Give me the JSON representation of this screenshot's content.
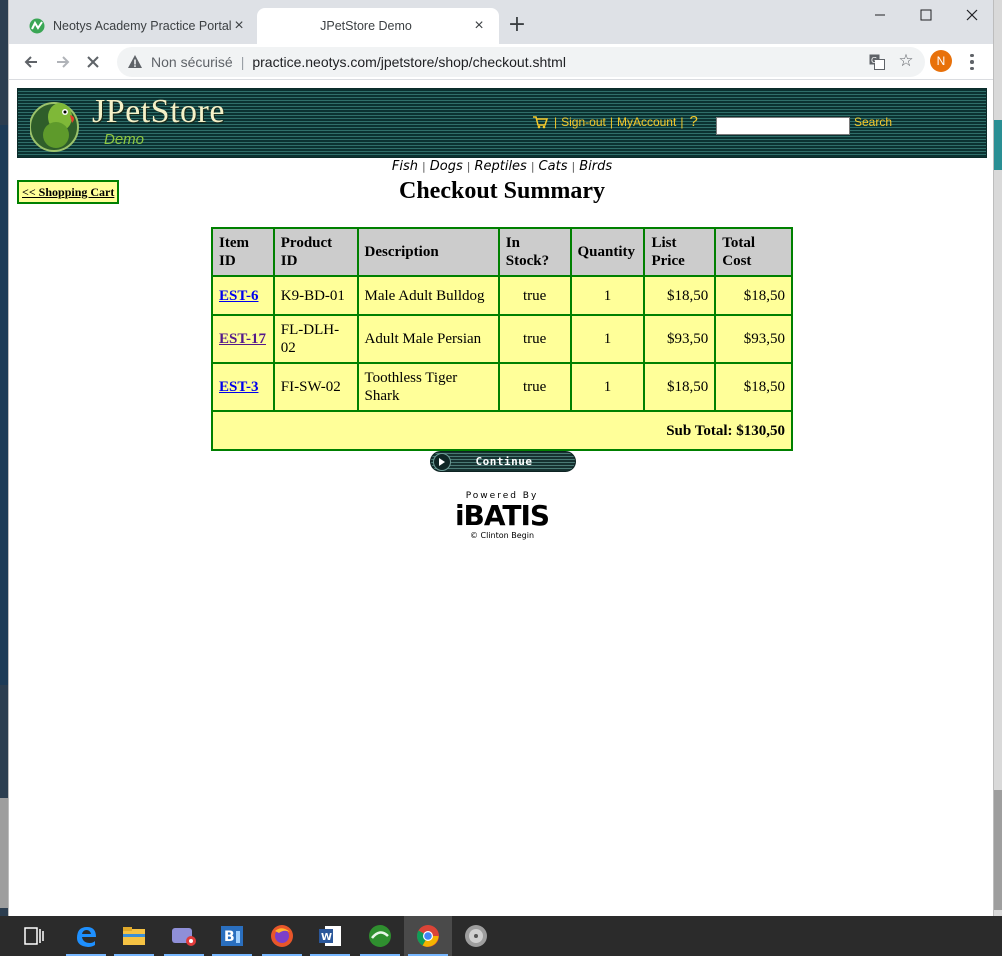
{
  "browser": {
    "tabs": [
      {
        "title": "Neotys Academy Practice Portal",
        "active": false
      },
      {
        "title": "JPetStore Demo",
        "active": true
      }
    ],
    "security_label": "Non sécurisé",
    "url": "practice.neotys.com/jpetstore/shop/checkout.shtml",
    "profile_initial": "N"
  },
  "header": {
    "logo_title": "JPetStore",
    "logo_subtitle": "Demo",
    "sign_out": "Sign-out",
    "my_account": "MyAccount",
    "help": "?",
    "search_label": "Search",
    "search_value": ""
  },
  "categories": [
    "Fish",
    "Dogs",
    "Reptiles",
    "Cats",
    "Birds"
  ],
  "back_link": "<< Shopping Cart",
  "page_title": "Checkout Summary",
  "table": {
    "headers": [
      "Item ID",
      "Product ID",
      "Description",
      "In Stock?",
      "Quantity",
      "List Price",
      "Total Cost"
    ],
    "rows": [
      {
        "item_id": "EST-6",
        "product_id": "K9-BD-01",
        "description": "Male Adult Bulldog",
        "in_stock": "true",
        "quantity": "1",
        "list_price": "$18,50",
        "total_cost": "$18,50"
      },
      {
        "item_id": "EST-17",
        "product_id": "FL-DLH-02",
        "description": "Adult Male Persian",
        "in_stock": "true",
        "quantity": "1",
        "list_price": "$93,50",
        "total_cost": "$93,50"
      },
      {
        "item_id": "EST-3",
        "product_id": "FI-SW-02",
        "description": "Toothless Tiger Shark",
        "in_stock": "true",
        "quantity": "1",
        "list_price": "$18,50",
        "total_cost": "$18,50"
      }
    ],
    "subtotal": "Sub Total: $130,50"
  },
  "continue_label": "Continue",
  "powered_by": {
    "line1": "Powered By",
    "brand": "iBATIS",
    "credit": "© Clinton Begin"
  },
  "colors": {
    "table_border": "#008000",
    "row_bg": "#ffff99",
    "header_bg": "#cccccc",
    "link": "#0000ee",
    "header_link": "#f6c92a"
  },
  "taskbar": [
    "task-view-icon",
    "edge-icon",
    "file-explorer-icon",
    "snipping-icon",
    "bi-app-icon",
    "firefox-icon",
    "word-icon",
    "neoload-icon",
    "chrome-icon",
    "disc-app-icon"
  ]
}
